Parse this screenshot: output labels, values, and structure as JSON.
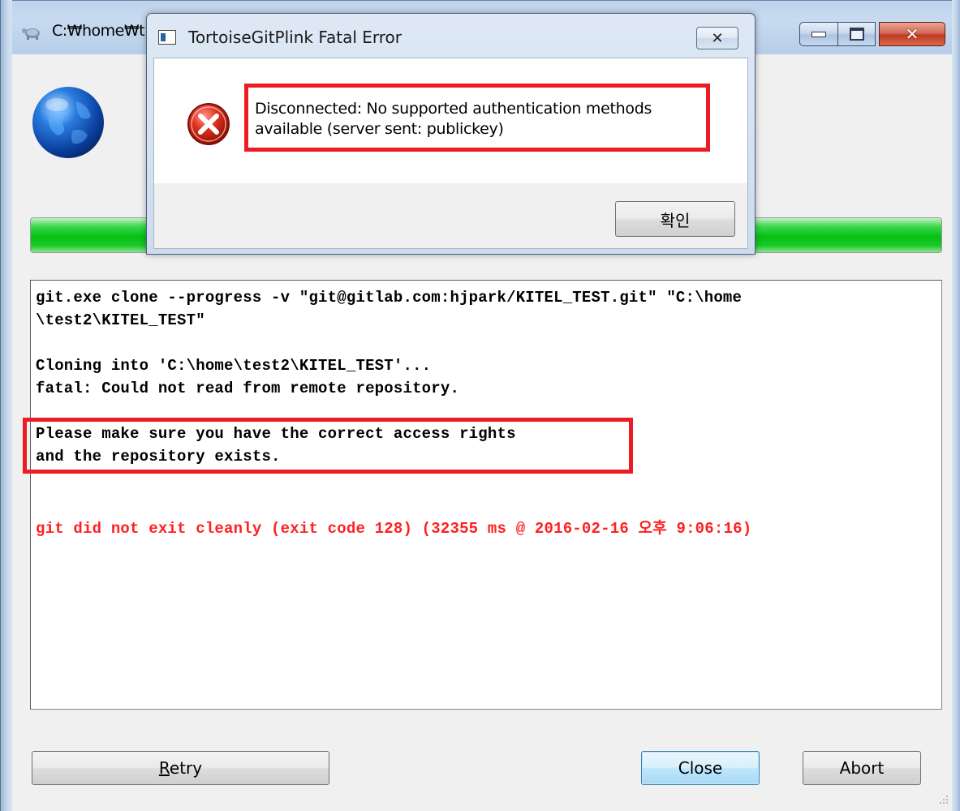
{
  "main_window": {
    "title": "C:₩home₩t",
    "progress_percent": 100,
    "buttons": {
      "retry": "Retry",
      "close": "Close",
      "abort": "Abort"
    }
  },
  "log": {
    "lines": [
      "git.exe clone --progress -v \"git@gitlab.com:hjpark/KITEL_TEST.git\" \"C:\\home",
      "\\test2\\KITEL_TEST\"",
      "Cloning into 'C:\\home\\test2\\KITEL_TEST'...",
      "fatal: Could not read from remote repository.",
      "Please make sure you have the correct access rights",
      "and the repository exists.",
      "git did not exit cleanly (exit code 128) (32355 ms @ 2016-02-16 오후 9:06:16)"
    ]
  },
  "error_dialog": {
    "title": "TortoiseGitPlink Fatal Error",
    "close_glyph": "✕",
    "message_line1": "Disconnected: No supported authentication methods",
    "message_line2": "available (server sent: publickey)",
    "ok_label": "확인"
  },
  "colors": {
    "highlight_red": "#ed1c24",
    "error_text_red": "#ff2020",
    "progress_green": "#06c014"
  }
}
